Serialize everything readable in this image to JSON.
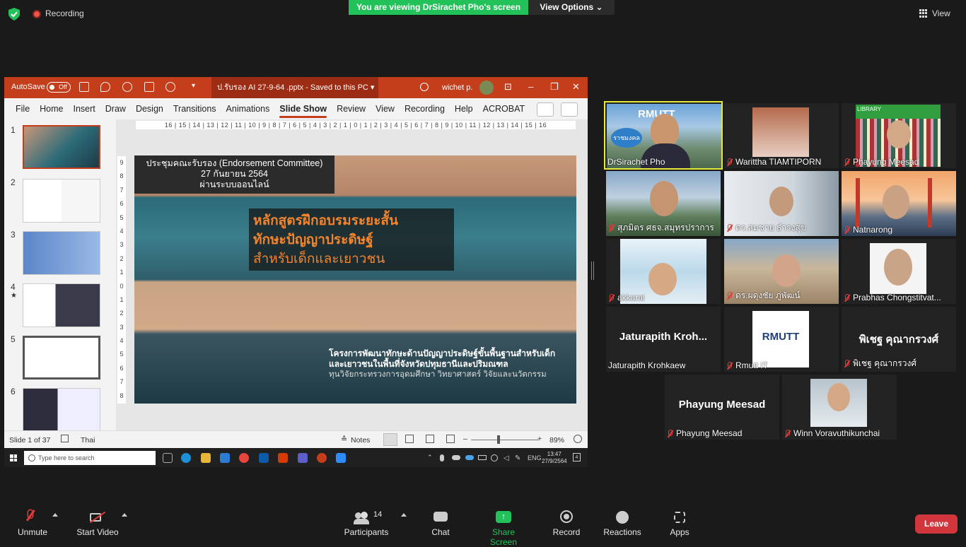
{
  "top_bar": {
    "recording_label": "Recording",
    "viewing_banner": "You are viewing DrSirachet Pho's screen",
    "view_options": "View Options",
    "view_label": "View"
  },
  "ppt": {
    "autosave": "AutoSave",
    "toggle": "Off",
    "filename": "ป.รับรอง AI 27-9-64 .pptx  -  Saved to this PC",
    "user": "wichet p.",
    "tabs": [
      "File",
      "Home",
      "Insert",
      "Draw",
      "Design",
      "Transitions",
      "Animations",
      "Slide Show",
      "Review",
      "View",
      "Recording",
      "Help",
      "ACROBAT"
    ],
    "active_tab": "Slide Show",
    "ruler_h": "16 | 15 | 14 | 13 | 12 | 11 | 10 | 9 | 8 | 7 | 6 | 5 | 4 | 3 | 2 | 1 | 0 | 1 | 2 | 3 | 4 | 5 | 6 | 7 | 8 | 9 | 10 | 11 | 12 | 13 | 14 | 15 | 16",
    "ruler_v": [
      "9",
      "8",
      "7",
      "6",
      "5",
      "4",
      "3",
      "2",
      "1",
      "0",
      "1",
      "2",
      "3",
      "4",
      "5",
      "6",
      "7",
      "8",
      "9"
    ],
    "thumb_numbers": [
      "1",
      "2",
      "3",
      "4",
      "5",
      "6"
    ],
    "thumb4_star": "★",
    "slide": {
      "meeting_1": "ประชุมคณะรับรอง (Endorsement Committee)",
      "meeting_2": "27 กันยายน 2564",
      "meeting_3": "ผ่านระบบออนไลน์",
      "title_1": "หลักสูตรฝึกอบรมระยะสั้น",
      "title_2": "ทักษะปัญญาประดิษฐ์",
      "title_3": "สำหรับเด็กและเยาวชน",
      "project_1": "โครงการพัฒนาทักษะด้านปัญญาประดิษฐ์ขั้นพื้นฐานสำหรับเด็ก",
      "project_2": "และเยาวชนในพื้นที่จังหวัดปทุมธานีและปริมณฑล",
      "project_3": "ทุนวิจัยกระทรวงการอุดมศึกษา วิทยาศาสตร์ วิจัยและนวัตกรรม"
    },
    "status": {
      "slide_count": "Slide 1 of 37",
      "language": "Thai",
      "notes": "Notes",
      "zoom": "89%"
    }
  },
  "taskbar": {
    "search_placeholder": "Type here to search",
    "lang": "ENG",
    "time": "13:47",
    "date": "27/9/2564",
    "notif": "4"
  },
  "participants": [
    {
      "name": "DrSirachet Pho",
      "muted": false
    },
    {
      "name": "Warittha TIAMTIPORN",
      "muted": true
    },
    {
      "name": "Phayung Meesad",
      "muted": true
    },
    {
      "name": "สุภมิตร ศธจ.สมุทรปราการ",
      "muted": true
    },
    {
      "name": "ดร.สมชาย ธำรงสุข",
      "muted": true
    },
    {
      "name": "Natnarong",
      "muted": true
    },
    {
      "name": "akkarat",
      "muted": true
    },
    {
      "name": "ดร.ผดุงชัย ภู่พัฒน์",
      "muted": true
    },
    {
      "name": "Prabhas Chongstitvat...",
      "muted": true
    },
    {
      "name": "Jaturapith Krohkaew",
      "muted": false,
      "big": "Jaturapith  Kroh..."
    },
    {
      "name": "Rmutt IT",
      "muted": true
    },
    {
      "name": "พิเชฐ  คุณากรวงศ์",
      "muted": true,
      "big": "พิเชฐ  คุณากรวงศ์"
    },
    {
      "name": "Phayung Meesad",
      "muted": true,
      "big": "Phayung Meesad"
    },
    {
      "name": "Winn Voravuthikunchai",
      "muted": true
    }
  ],
  "logos": {
    "rmutt": "RMUTT",
    "rajamangala": "ราชมงคล",
    "library": "LIBRARY"
  },
  "toolbar": {
    "unmute": "Unmute",
    "start_video": "Start Video",
    "participants": "Participants",
    "participant_count": "14",
    "chat": "Chat",
    "share_screen": "Share Screen",
    "record": "Record",
    "reactions": "Reactions",
    "apps": "Apps",
    "leave": "Leave"
  },
  "colors": {
    "ppt_accent": "#c43e1c",
    "share_green": "#23c15a",
    "leave_red": "#d1363c",
    "speaker_border": "#e6e83a"
  }
}
